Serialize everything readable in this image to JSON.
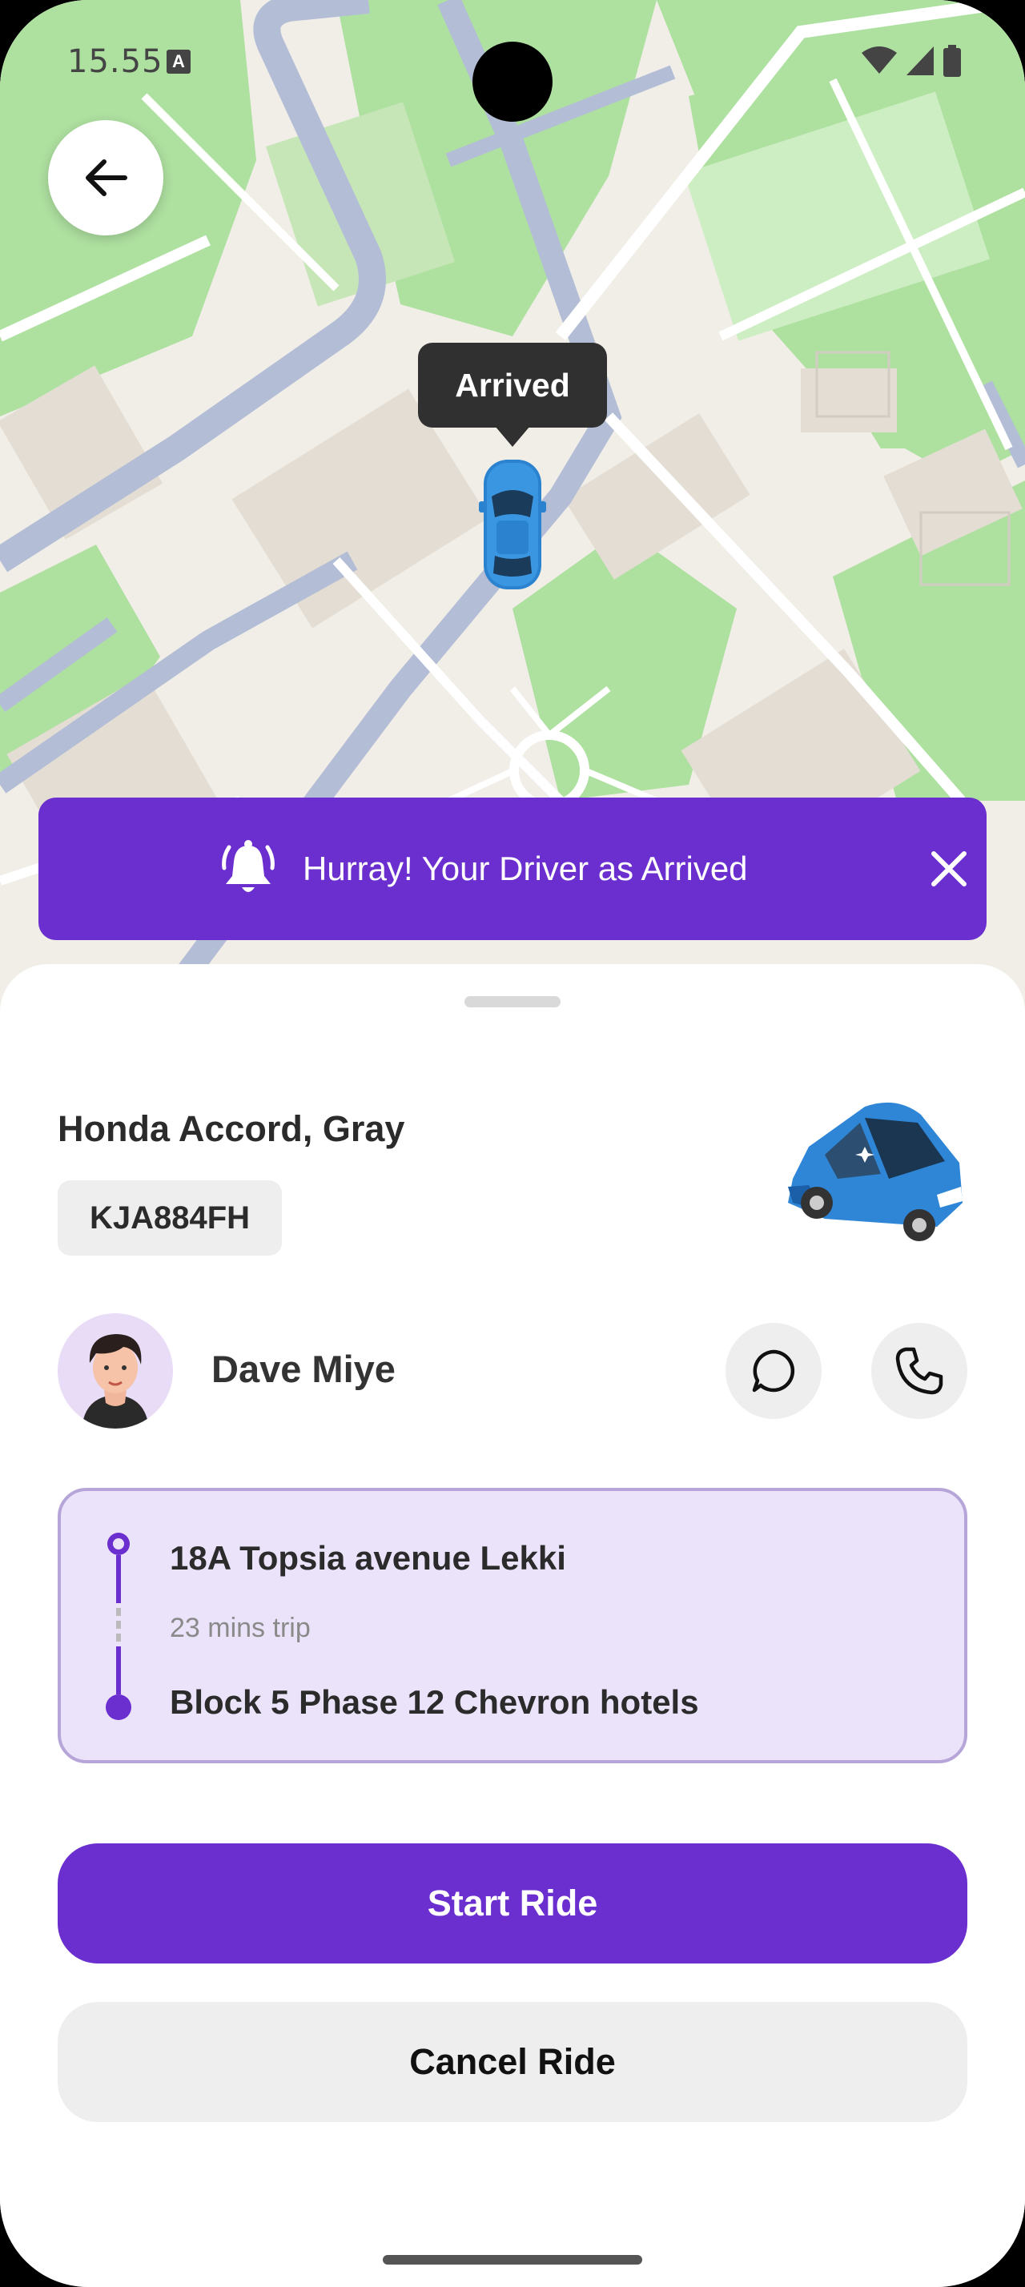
{
  "status_bar": {
    "time": "15.55",
    "left_icon": "a-notification-icon",
    "right_icons": [
      "wifi-icon",
      "signal-icon",
      "battery-icon"
    ]
  },
  "map": {
    "back_icon": "arrow-left-icon",
    "marker_label": "Arrived",
    "marker_icon": "car-marker-icon"
  },
  "banner": {
    "icon": "bell-ring-icon",
    "message": "Hurray! Your Driver as Arrived",
    "close_icon": "close-icon",
    "color": "#6a2fce"
  },
  "vehicle": {
    "title": "Honda Accord, Gray",
    "plate": "KJA884FH",
    "image_icon": "car-image-icon"
  },
  "driver": {
    "name": "Dave Miye",
    "avatar_icon": "avatar-icon",
    "chat_icon": "chat-icon",
    "call_icon": "phone-icon"
  },
  "route": {
    "from": "18A Topsia avenue Lekki",
    "duration": "23 mins trip",
    "to": "Block 5 Phase 12 Chevron hotels"
  },
  "actions": {
    "start": "Start Ride",
    "cancel": "Cancel Ride"
  },
  "colors": {
    "primary": "#6a2fce",
    "route_card_bg": "#ebe3fa",
    "route_card_border": "#b6a5d8"
  }
}
